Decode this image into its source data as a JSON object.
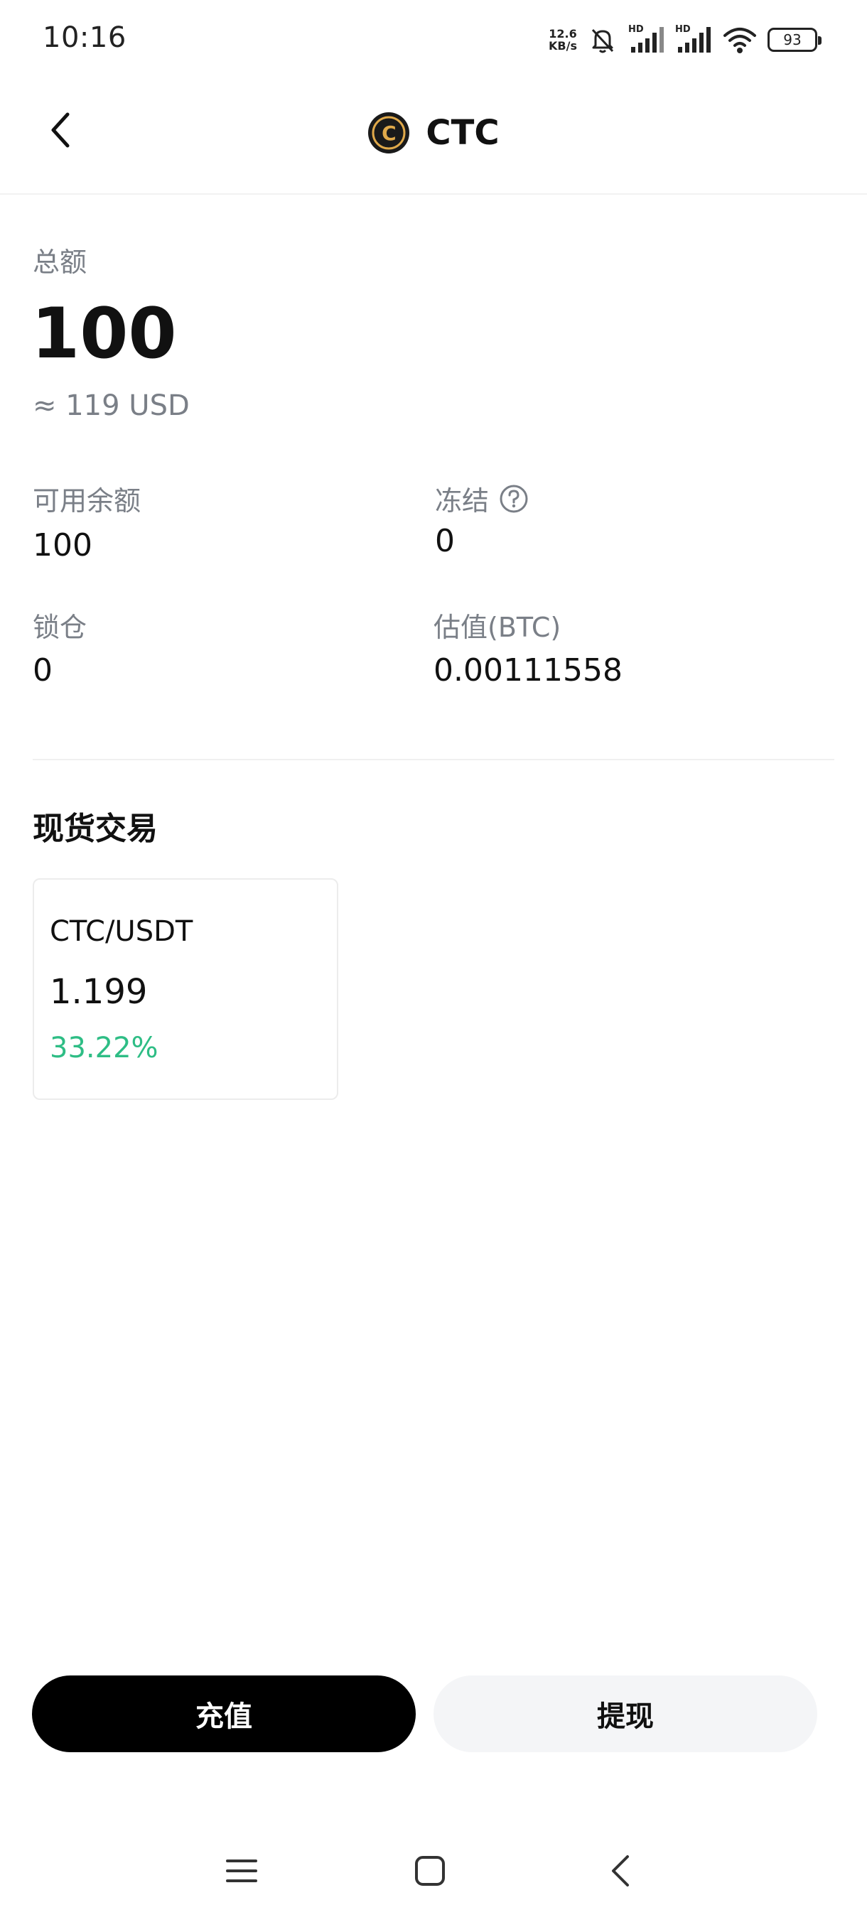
{
  "status_bar": {
    "time": "10:16",
    "net_speed_value": "12.6",
    "net_speed_unit": "KB/s",
    "signal1_label": "HD",
    "signal2_label": "HD",
    "battery": "93"
  },
  "header": {
    "title": "CTC",
    "logo_letter": "C"
  },
  "summary": {
    "total_label": "总额",
    "total_value": "100",
    "total_usd": "≈ 119 USD"
  },
  "details": {
    "available_label": "可用余额",
    "available_value": "100",
    "frozen_label": "冻结",
    "frozen_value": "0",
    "locked_label": "锁仓",
    "locked_value": "0",
    "valuation_label": "估值(BTC)",
    "valuation_value": "0.00111558"
  },
  "spot": {
    "section_title": "现货交易",
    "pairs": [
      {
        "name": "CTC/USDT",
        "price": "1.199",
        "change": "33.22%"
      }
    ]
  },
  "actions": {
    "deposit_label": "充值",
    "withdraw_label": "提现"
  },
  "colors": {
    "positive": "#2ebd85",
    "primary_button": "#000000",
    "secondary_button": "#f4f5f7",
    "muted_text": "#7a7f87",
    "coin_gold": "#e0a94a"
  },
  "icons": {
    "back": "chevron-left-icon",
    "help": "question-circle-icon",
    "nav_menu": "menu-icon",
    "nav_home": "home-square-icon",
    "nav_back": "chevron-left-icon"
  }
}
